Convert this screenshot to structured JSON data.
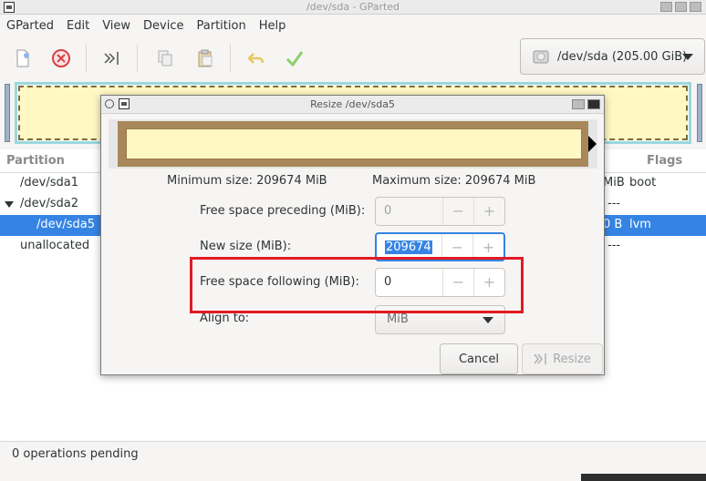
{
  "window": {
    "title": "/dev/sda - GParted"
  },
  "menubar": {
    "items": [
      "GParted",
      "Edit",
      "View",
      "Device",
      "Partition",
      "Help"
    ]
  },
  "toolbar": {
    "buttons": [
      "new-icon",
      "delete-icon",
      "resize-move-icon",
      "copy-icon",
      "paste-icon",
      "undo-icon",
      "apply-icon"
    ],
    "device_label": "/dev/sda (205.00 GiB)"
  },
  "partition_list": {
    "headers": {
      "partition": "Partition",
      "flags": "Flags"
    },
    "rows": [
      {
        "name": "/dev/sda1",
        "tail": "MiB",
        "flags": "boot"
      },
      {
        "name": "/dev/sda2",
        "tail": "",
        "flags": "---"
      },
      {
        "name": "/dev/sda5",
        "tail": "0 B",
        "flags": "lvm"
      },
      {
        "name": "unallocated",
        "tail": "",
        "flags": "---"
      }
    ]
  },
  "statusbar": {
    "text": "0 operations pending"
  },
  "dialog": {
    "title": "Resize /dev/sda5",
    "min_size": "Minimum size: 209674 MiB",
    "max_size": "Maximum size: 209674 MiB",
    "free_preceding_label": "Free space preceding (MiB):",
    "free_preceding_value": "0",
    "new_size_label": "New size (MiB):",
    "new_size_value": "209674",
    "free_following_label": "Free space following (MiB):",
    "free_following_value": "0",
    "align_label": "Align to:",
    "align_value": "MiB",
    "cancel_label": "Cancel",
    "resize_label": "Resize",
    "minus_glyph": "−",
    "plus_glyph": "+"
  },
  "colors": {
    "accent": "#3584e4",
    "highlight": "#e01b24",
    "partition_fill": "#fff8c4",
    "partition_border": "#a8885a"
  }
}
